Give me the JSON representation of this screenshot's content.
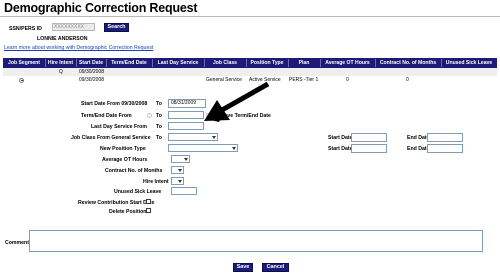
{
  "page": {
    "title": "Demographic Correction Request"
  },
  "search": {
    "ssn_label": "SSN/PERS ID",
    "ssn_value": "XXXXXXXXX",
    "button": "Search",
    "name": "LONNIE ANDERSON",
    "learn_more": "Learn more about working with Demographic Correction Request"
  },
  "table": {
    "headers": [
      "Job Segment",
      "Hire Intent",
      "Start Date",
      "Term/End Date",
      "Last Day Service",
      "Job Class",
      "Position Type",
      "Plan",
      "Average OT Hours",
      "Contract No. of Months",
      "Unused Sick Leave"
    ],
    "rows": [
      {
        "hire_intent": "Q",
        "start_date": "09/30/2008",
        "term_end": "",
        "last_day": "",
        "job_class": "",
        "position_type": "",
        "plan": ""
      },
      {
        "hire_intent": "",
        "start_date": "09/30/2008",
        "term_end": "",
        "last_day": "",
        "job_class": "General Service",
        "position_type": "Active Service",
        "plan": "PERS -Tier 1",
        "avg_ot": "0",
        "contract_months": "0"
      }
    ]
  },
  "form": {
    "start_date_from": "Start Date From 09/30/2008",
    "to": "To",
    "start_date_to_value": "08/31/2009",
    "term_end_from": "Term/End Date From",
    "remove_term_end": "Remove Term/End Date",
    "last_day_from": "Last Day Service From",
    "job_class_from": "Job Class From General Service",
    "new_position_type": "New Position Type",
    "start_date": "Start Date",
    "end_date": "End Date",
    "average_ot": "Average OT Hours",
    "contract_months": "Contract No. of Months",
    "hire_intent": "Hire Intent",
    "unused_sick": "Unused Sick Leave",
    "review_contribution": "Review Contribution Start Date",
    "delete_position": "Delete Position"
  },
  "comments": {
    "label": "Comments"
  },
  "actions": {
    "save": "Save",
    "cancel": "Cancel"
  },
  "colors": {
    "header_bg": "#1c1c78",
    "link": "#1a3fb0",
    "row_alt": "#efefef"
  }
}
